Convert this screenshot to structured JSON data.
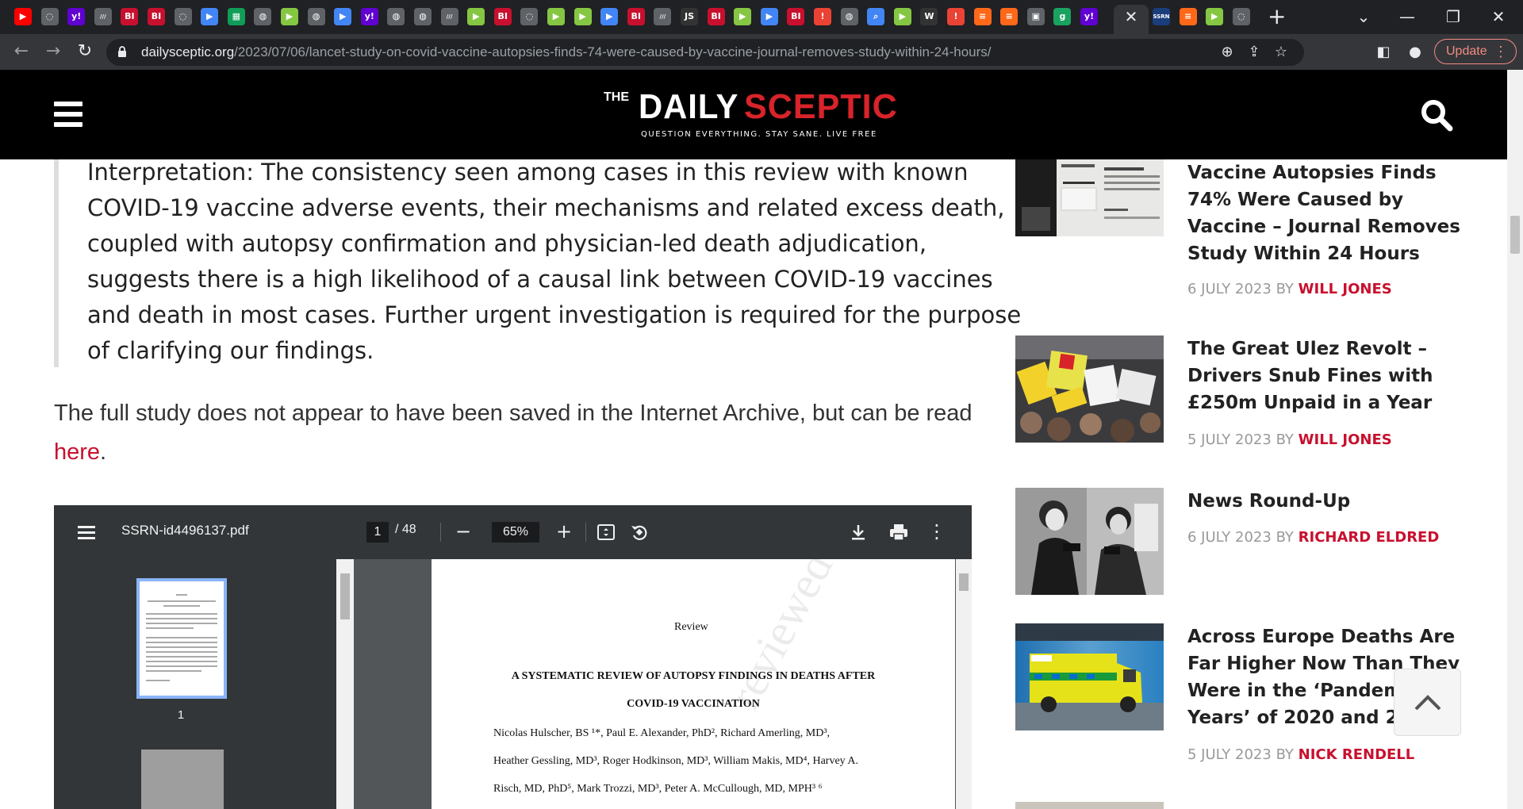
{
  "browser": {
    "tabs": [
      {
        "icon": "youtube-icon",
        "glyph": "▶",
        "color": "#ff0000"
      },
      {
        "icon": "generic-site-icon",
        "glyph": "◌",
        "color": "#5f6368"
      },
      {
        "icon": "yahoo-icon",
        "glyph": "y!",
        "color": "#6001d2"
      },
      {
        "icon": "news-icon",
        "glyph": "///",
        "color": "#5f6368"
      },
      {
        "icon": "bi-icon",
        "glyph": "BI",
        "color": "#c8102e"
      },
      {
        "icon": "bi-icon",
        "glyph": "BI",
        "color": "#c8102e"
      },
      {
        "icon": "generic-site-icon",
        "glyph": "◌",
        "color": "#5f6368"
      },
      {
        "icon": "arrow-site-icon",
        "glyph": "▶",
        "color": "#4285f4"
      },
      {
        "icon": "sheets-icon",
        "glyph": "▦",
        "color": "#0f9d58"
      },
      {
        "icon": "globe-icon",
        "glyph": "◍",
        "color": "#5f6368"
      },
      {
        "icon": "rumble-icon",
        "glyph": "▶",
        "color": "#85c742"
      },
      {
        "icon": "globe-icon",
        "glyph": "◍",
        "color": "#5f6368"
      },
      {
        "icon": "arrow-site-icon",
        "glyph": "▶",
        "color": "#4285f4"
      },
      {
        "icon": "yahoo-icon",
        "glyph": "y!",
        "color": "#6001d2"
      },
      {
        "icon": "globe-icon",
        "glyph": "◍",
        "color": "#5f6368"
      },
      {
        "icon": "globe-icon",
        "glyph": "◍",
        "color": "#5f6368"
      },
      {
        "icon": "news-icon",
        "glyph": "///",
        "color": "#5f6368"
      },
      {
        "icon": "rumble-icon",
        "glyph": "▶",
        "color": "#85c742"
      },
      {
        "icon": "bi-icon",
        "glyph": "BI",
        "color": "#c8102e"
      },
      {
        "icon": "generic-site-icon",
        "glyph": "◌",
        "color": "#5f6368"
      },
      {
        "icon": "rumble-icon",
        "glyph": "▶",
        "color": "#85c742"
      },
      {
        "icon": "rumble-icon",
        "glyph": "▶",
        "color": "#85c742"
      },
      {
        "icon": "arrow-site-icon",
        "glyph": "▶",
        "color": "#4285f4"
      },
      {
        "icon": "bi-icon",
        "glyph": "BI",
        "color": "#c8102e"
      },
      {
        "icon": "news-icon",
        "glyph": "///",
        "color": "#5f6368"
      },
      {
        "icon": "js-icon",
        "glyph": "JS",
        "color": "#333333"
      },
      {
        "icon": "bi-icon",
        "glyph": "BI",
        "color": "#c8102e"
      },
      {
        "icon": "rumble-icon",
        "glyph": "▶",
        "color": "#85c742"
      },
      {
        "icon": "arrow-site-icon",
        "glyph": "▶",
        "color": "#4285f4"
      },
      {
        "icon": "bi-icon",
        "glyph": "BI",
        "color": "#c8102e"
      },
      {
        "icon": "alert-icon",
        "glyph": "!",
        "color": "#ea4335"
      },
      {
        "icon": "globe-icon",
        "glyph": "◍",
        "color": "#5f6368"
      },
      {
        "icon": "search-site-icon",
        "glyph": "⌕",
        "color": "#4285f4"
      },
      {
        "icon": "rumble-icon",
        "glyph": "▶",
        "color": "#85c742"
      },
      {
        "icon": "news-icon",
        "glyph": "W",
        "color": "#333333"
      },
      {
        "icon": "alert-icon",
        "glyph": "!",
        "color": "#ea4335"
      },
      {
        "icon": "substack-icon",
        "glyph": "≡",
        "color": "#ff6719"
      },
      {
        "icon": "substack-icon",
        "glyph": "≡",
        "color": "#ff6719"
      },
      {
        "icon": "image-icon",
        "glyph": "▣",
        "color": "#5f6368"
      },
      {
        "icon": "g-icon",
        "glyph": "g",
        "color": "#1aa260"
      },
      {
        "icon": "yahoo-icon",
        "glyph": "y!",
        "color": "#6001d2"
      }
    ],
    "tabs_after": [
      {
        "icon": "ssrn-icon",
        "glyph": "SSRN",
        "color": "#1a3d7c"
      },
      {
        "icon": "substack-icon",
        "glyph": "≡",
        "color": "#ff6719"
      },
      {
        "icon": "rumble-icon",
        "glyph": "▶",
        "color": "#85c742"
      },
      {
        "icon": "generic-site-icon",
        "glyph": "◌",
        "color": "#5f6368"
      }
    ],
    "close_glyph": "✕",
    "newtab_glyph": "+",
    "url_host": "dailysceptic.org",
    "url_path": "/2023/07/06/lancet-study-on-covid-vaccine-autopsies-finds-74-were-caused-by-vaccine-journal-removes-study-within-24-hours/",
    "update_label": "Update"
  },
  "site": {
    "logo_the": "THE",
    "logo_daily": "DAILY",
    "logo_sceptic": "SCEPTIC",
    "tagline": "QUESTION EVERYTHING. STAY SANE. LIVE FREE",
    "brand_red": "#d8232a"
  },
  "article": {
    "quote": "Interpretation: The consistency seen among cases in this review with known COVID-19 vaccine adverse events, their mechanisms and related excess death, coupled with autopsy confirmation and physician-led death adjudication, suggests there is a high likelihood of a causal link between COVID-19 vaccines and death in most cases. Further urgent investigation is required for the purpose of clarifying our findings.",
    "para_text": "The full study does not appear to have been saved in the Internet Archive, but can be read ",
    "para_link": "here",
    "para_end": "."
  },
  "pdf": {
    "filename": "SSRN-id4496137.pdf",
    "page": "1",
    "page_total": "/ 48",
    "zoom": "65%",
    "thumb_number": "1",
    "review_label": "Review",
    "title": "A SYSTEMATIC REVIEW OF AUTOPSY FINDINGS IN DEATHS AFTER COVID-19 VACCINATION",
    "authors_line1": "Nicolas Hulscher, BS ¹*, Paul E. Alexander, PhD², Richard Amerling, MD³,",
    "authors_line2": "Heather Gessling, MD³, Roger Hodkinson, MD³, William Makis, MD⁴, Harvey A.",
    "authors_line3": "Risch, MD, PhD⁵, Mark Trozzi, MD³, Peter A. McCullough, MD, MPH³ ⁶",
    "watermark": "reviewed"
  },
  "sidebar": {
    "posts": [
      {
        "title": "Vaccine Autopsies Finds 74% Were Caused by Vaccine – Journal Removes Study Within 24 Hours",
        "date": "6 JULY 2023",
        "by": "BY",
        "author": "WILL JONES"
      },
      {
        "title": "The Great Ulez Revolt – Drivers Snub Fines with £250m Unpaid in a Year",
        "date": "5 JULY 2023",
        "by": "BY",
        "author": "WILL JONES"
      },
      {
        "title": "News Round-Up",
        "date": "6 JULY 2023",
        "by": "BY",
        "author": "RICHARD ELDRED"
      },
      {
        "title": "Across Europe Deaths Are Far Higher Now Than They Were in the ‘Pandemic Years’ of 2020 and 2021",
        "date": "5 JULY 2023",
        "by": "BY",
        "author": "NICK RENDELL"
      }
    ]
  }
}
